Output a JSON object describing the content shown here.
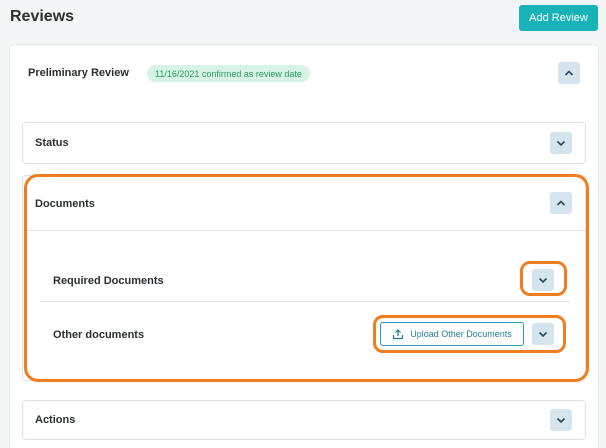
{
  "header": {
    "title": "Reviews",
    "add_button_label": "Add Review"
  },
  "review": {
    "title": "Preliminary Review",
    "date_badge": "11/16/2021 confirmed as review date",
    "expanded": true,
    "sections": {
      "status": {
        "title": "Status",
        "expanded": false
      },
      "documents": {
        "title": "Documents",
        "expanded": true,
        "subsections": {
          "required": {
            "title": "Required Documents",
            "expanded": false
          },
          "other": {
            "title": "Other documents",
            "expanded": false,
            "upload_button_label": "Upload Other Documents"
          }
        }
      },
      "actions": {
        "title": "Actions",
        "expanded": false
      }
    }
  },
  "colors": {
    "accent": "#17b3b8",
    "badge_bg": "#d6f3e6",
    "badge_text": "#2e9a63",
    "highlight": "#f07d1e",
    "toggle_bg": "#d5e5ee",
    "link": "#1f7f99"
  },
  "icons": {
    "toggle_open": "chevron-up-icon",
    "toggle_closed": "chevron-down-icon",
    "upload": "upload-icon"
  }
}
